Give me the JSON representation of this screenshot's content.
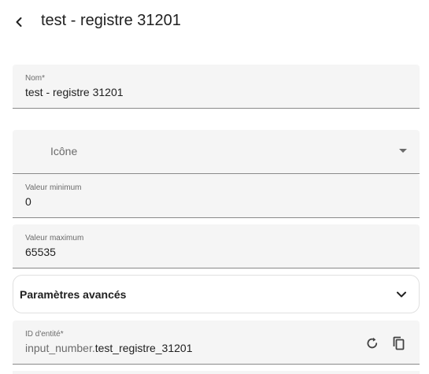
{
  "header": {
    "title": "test - registre 31201",
    "back_icon": "chevron-left-icon"
  },
  "form": {
    "name": {
      "label": "Nom*",
      "value": "test - registre 31201"
    },
    "icon": {
      "placeholder": "Icône",
      "dropdown_icon": "arrow-drop-down-icon"
    },
    "min": {
      "label": "Valeur minimum",
      "value": "0"
    },
    "max": {
      "label": "Valeur maximum",
      "value": "65535"
    },
    "advanced": {
      "label": "Paramètres avancés",
      "expand_icon": "chevron-down-icon"
    },
    "entity_id": {
      "label": "ID d'entité*",
      "prefix": "input_number.",
      "value": "test_registre_31201",
      "restore_icon": "restore-icon",
      "copy_icon": "copy-icon"
    }
  }
}
